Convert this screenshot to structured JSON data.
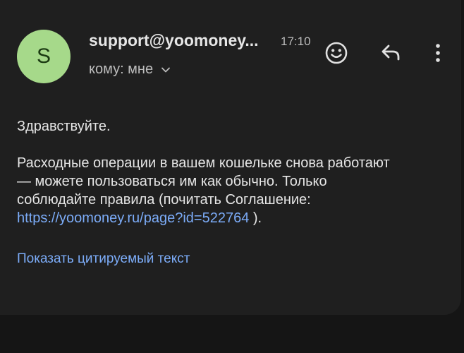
{
  "email": {
    "avatar_letter": "S",
    "sender": "support@yoomoney...",
    "time": "17:10",
    "recipient": "кому: мне",
    "greeting": "Здравствуйте.",
    "body_line1": "Расходные операции в вашем кошельке снова работают",
    "body_line2": "— можете пользоваться им как обычно. Только",
    "body_line3": "соблюдайте правила (почитать Соглашение:",
    "link": "https://yoomoney.ru/page?id=522764",
    "link_suffix": " ).",
    "show_quoted": "Показать цитируемый текст"
  },
  "actions": {
    "emoji_icon": "smiley-icon",
    "reply_icon": "reply-icon",
    "more_icon": "more-vertical-icon"
  },
  "colors": {
    "background": "#151515",
    "card": "#1f1f1f",
    "avatar": "#a6d98a",
    "link": "#7cacf8"
  }
}
